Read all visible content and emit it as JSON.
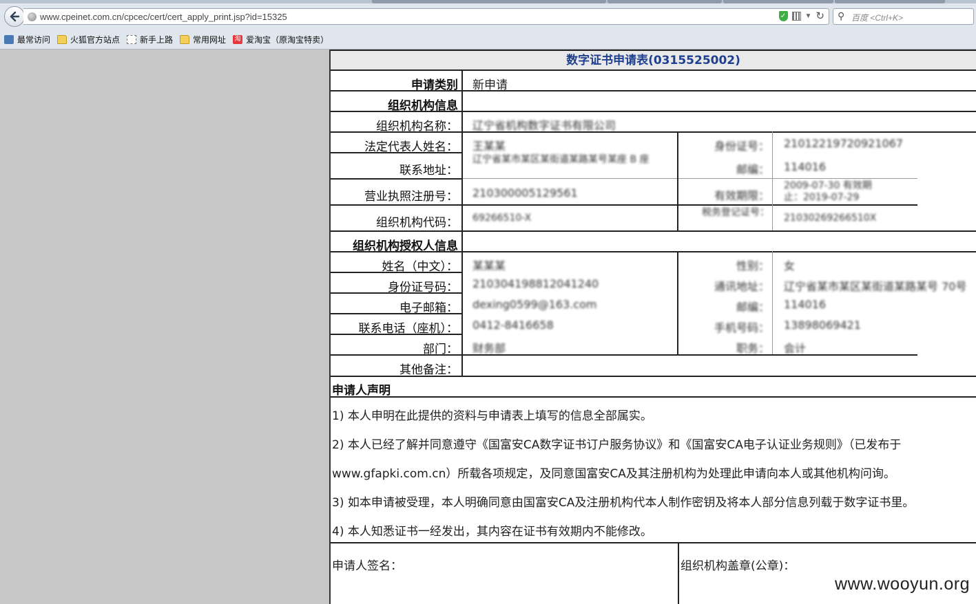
{
  "browser": {
    "url": "www.cpeinet.com.cn/cpcec/cert/cert_apply_print.jsp?id=15325",
    "search_placeholder": "百度 <Ctrl+K>",
    "bookmarks": [
      "最常访问",
      "火狐官方站点",
      "新手上路",
      "常用网址",
      "爱淘宝（原淘宝特卖）"
    ],
    "icons": [
      "back-arrow-icon",
      "globe-icon",
      "shield-icon",
      "qr-code-icon",
      "dropdown-icon",
      "reload-icon",
      "search-icon"
    ]
  },
  "form": {
    "title": "数字证书申请表(0315525002)",
    "apply_type_label": "申请类别",
    "apply_type_value": "新申请",
    "org_section": "组织机构信息",
    "org_name_label": "组织机构名称：",
    "org_name_value": "辽宁省机构数字证书有限公司",
    "legal_rep_label": "法定代表人姓名：",
    "legal_rep_value": "王某某",
    "legal_id_label": "身份证号：",
    "legal_id_value": "21012219720921067",
    "address_label": "联系地址：",
    "address_value": "辽宁省某市某区某街道某路某号某座 B 座",
    "postcode_label": "邮编：",
    "postcode_value": "114016",
    "license_label": "营业执照注册号：",
    "license_value": "210300005129561",
    "validity_label": "有效期限：",
    "validity_value_1": "2009-07-30 有效期",
    "validity_value_2": "止：2019-07-29",
    "org_code_label": "组织机构代码：",
    "org_code_value": "69266510-X",
    "tax_label": "税务登记证号：",
    "tax_value": "21030269266510X",
    "auth_section": "组织机构授权人信息",
    "name_label": "姓名（中文）：",
    "name_value": "某某某",
    "gender_label": "性别：",
    "gender_value": "女",
    "id_label": "身份证号码：",
    "id_value": "210304198812041240",
    "contact_addr_label": "通讯地址：",
    "contact_addr_value": "辽宁省某市某区某街道某路某号 70号",
    "email_label": "电子邮箱：",
    "email_value": "dexing0599@163.com",
    "zip_label": "邮编：",
    "zip_value": "114016",
    "phone_label": "联系电话（座机）：",
    "phone_value": "0412-8416658",
    "mobile_label": "手机号码：",
    "mobile_value": "13898069421",
    "dept_label": "部门：",
    "dept_value": "财务部",
    "position_label": "职务：",
    "position_value": "会计",
    "remarks_label": "其他备注：",
    "remarks_value": "",
    "declaration_head": "申请人声明",
    "declarations": [
      "1) 本人申明在此提供的资料与申请表上填写的信息全部属实。",
      "2) 本人已经了解并同意遵守《国富安CA数字证书订户服务协议》和《国富安CA电子认证业务规则》（已发布于",
      "www.gfapki.com.cn）所载各项规定，及同意国富安CA及其注册机构为处理此申请向本人或其他机构问询。",
      "3) 如本申请被受理，本人明确同意由国富安CA及注册机构代本人制作密钥及将本人部分信息列载于数字证书里。",
      "4) 本人知悉证书一经发出，其内容在证书有效期内不能修改。"
    ],
    "signature_label": "申请人签名：",
    "seal_label": "组织机构盖章(公章)："
  },
  "watermark": "www.wooyun.org"
}
